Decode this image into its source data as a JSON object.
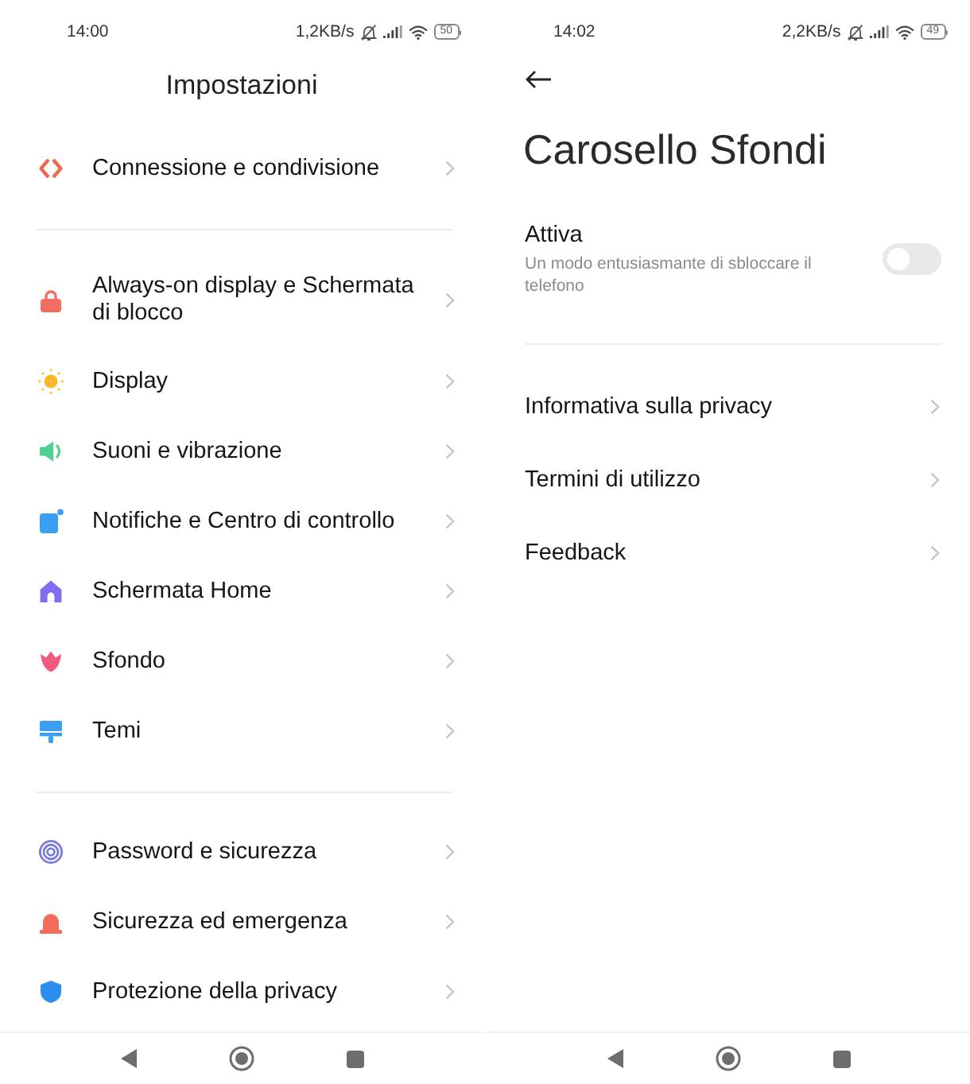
{
  "screens": [
    {
      "kind": "settings_list",
      "status_bar": {
        "time": "14:00",
        "speed": "1,2KB/s",
        "battery": "50"
      },
      "title": "Impostazioni",
      "sections": [
        {
          "items": [
            {
              "label": "Connessione e condivisione"
            }
          ]
        },
        {
          "items": [
            {
              "label": "Always-on display e Schermata di blocco"
            },
            {
              "label": "Display"
            },
            {
              "label": "Suoni e vibrazione"
            },
            {
              "label": "Notifiche e Centro di controllo"
            },
            {
              "label": "Schermata Home"
            },
            {
              "label": "Sfondo"
            },
            {
              "label": "Temi"
            }
          ]
        },
        {
          "items": [
            {
              "label": "Password e sicurezza"
            },
            {
              "label": "Sicurezza ed emergenza"
            },
            {
              "label": "Protezione della privacy"
            }
          ]
        }
      ]
    },
    {
      "kind": "detail_page",
      "status_bar": {
        "time": "14:02",
        "speed": "2,2KB/s",
        "battery": "49"
      },
      "title": "Carosello Sfondi",
      "toggle_row": {
        "label": "Attiva",
        "description": "Un modo entusiasmante di sbloccare il telefono",
        "on": false
      },
      "links": [
        {
          "label": "Informativa sulla privacy"
        },
        {
          "label": "Termini di utilizzo"
        },
        {
          "label": "Feedback"
        }
      ]
    }
  ]
}
